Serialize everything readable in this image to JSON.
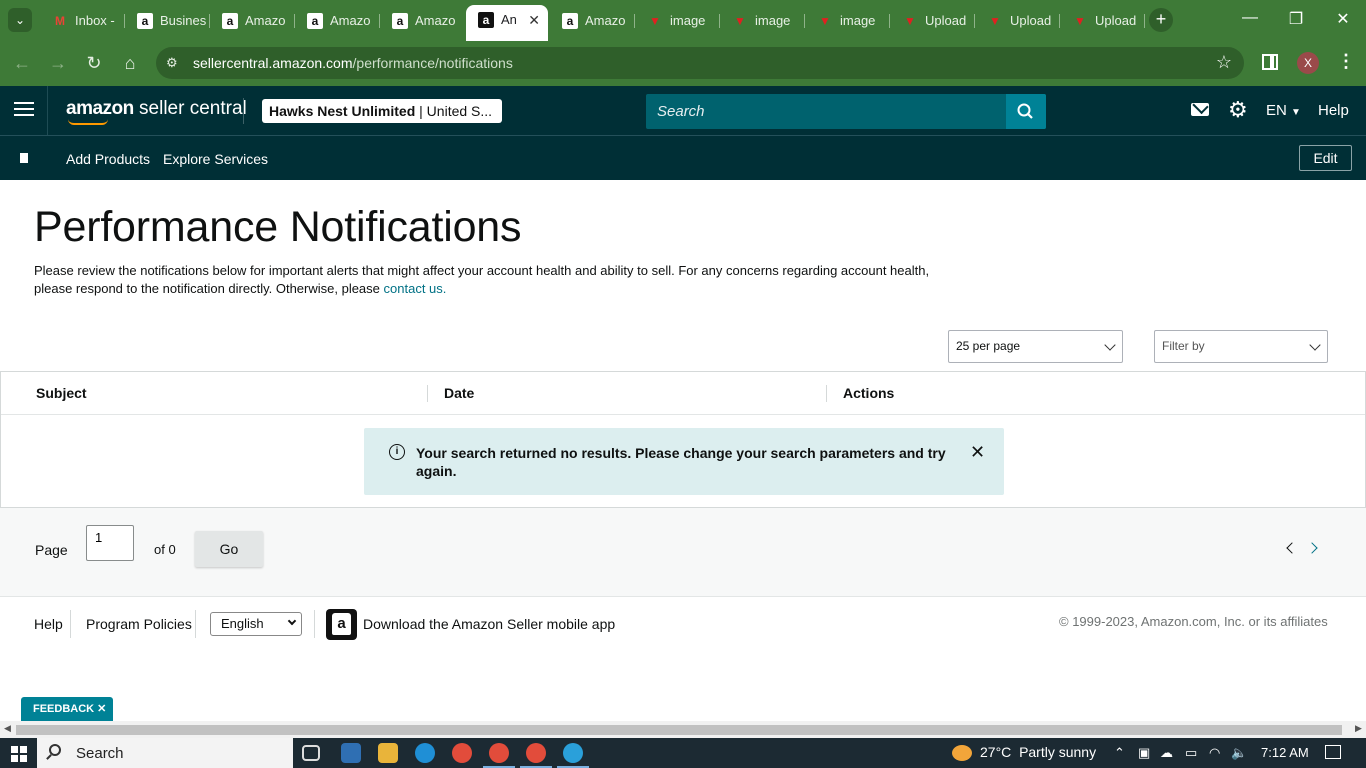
{
  "browser": {
    "tabs": [
      {
        "label": "Inbox -",
        "icon": "gmail-icon"
      },
      {
        "label": "Busines",
        "icon": "amazon-icon"
      },
      {
        "label": "Amazo",
        "icon": "amazon-icon"
      },
      {
        "label": "Amazo",
        "icon": "amazon-icon"
      },
      {
        "label": "Amazo",
        "icon": "amazon-icon"
      },
      {
        "label": "An",
        "icon": "amazon-icon",
        "active": true
      },
      {
        "label": "Amazo",
        "icon": "amazon-icon"
      },
      {
        "label": "image",
        "icon": "upload-icon"
      },
      {
        "label": "image",
        "icon": "upload-icon"
      },
      {
        "label": "image",
        "icon": "upload-icon"
      },
      {
        "label": "Upload",
        "icon": "upload-icon"
      },
      {
        "label": "Upload",
        "icon": "upload-icon"
      },
      {
        "label": "Upload",
        "icon": "upload-icon"
      }
    ],
    "url_host": "sellercentral.amazon.com",
    "url_path": "/performance/notifications",
    "profile_initial": "X",
    "theme_color": "#3e7a37"
  },
  "header": {
    "logo_amazon": "amazon",
    "logo_product": "seller central",
    "store_name": "Hawks Nest Unlimited",
    "store_region": "| United S...",
    "search_placeholder": "Search",
    "language": "EN",
    "help": "Help",
    "bg_color": "#002f36"
  },
  "subnav": {
    "items": [
      "Add Products",
      "Explore Services"
    ],
    "edit": "Edit"
  },
  "main": {
    "title": "Performance Notifications",
    "intro_text": "Please review the notifications below for important alerts that might affect your account health and ability to sell. For any concerns regarding account health, please respond to the notification directly. Otherwise, please ",
    "intro_link": "contact us.",
    "per_page": "25 per page",
    "filter_placeholder": "Filter by",
    "columns": [
      "Subject",
      "Date",
      "Actions"
    ],
    "alert_message": "Your search returned no results. Please change your search parameters and try again."
  },
  "pager": {
    "page_label": "Page",
    "page_value": "1",
    "of_label": "of 0",
    "go": "Go"
  },
  "footer": {
    "help": "Help",
    "policies": "Program Policies",
    "language": "English",
    "app_text": "Download the Amazon Seller mobile app",
    "copyright": "© 1999-2023, Amazon.com, Inc. or its affiliates"
  },
  "feedback": "FEEDBACK ✕",
  "taskbar": {
    "search": "Search",
    "temperature": "27°C",
    "weather": "Partly sunny",
    "time": "7:12 AM"
  }
}
